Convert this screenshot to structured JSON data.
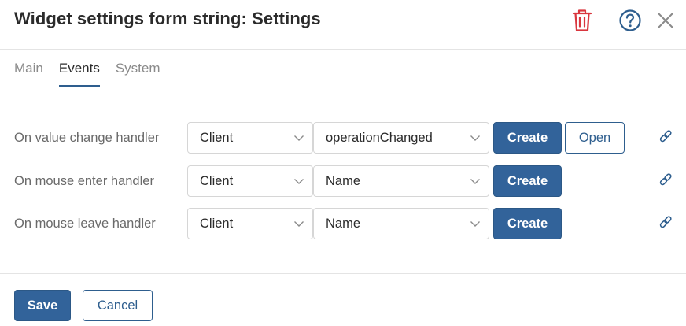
{
  "header": {
    "title": "Widget settings form string: Settings",
    "delete_icon": "trash-icon",
    "help_icon": "help-circle-icon",
    "close_icon": "close-icon",
    "delete_color": "#d9363e",
    "accent_color": "#2e5e8e"
  },
  "tabs": [
    {
      "label": "Main",
      "active": false
    },
    {
      "label": "Events",
      "active": true
    },
    {
      "label": "System",
      "active": false
    }
  ],
  "rows": [
    {
      "label": "On value change handler",
      "type": "Client",
      "handler": "operationChanged",
      "create_label": "Create",
      "open_label": "Open"
    },
    {
      "label": "On mouse enter handler",
      "type": "Client",
      "handler": "Name",
      "create_label": "Create"
    },
    {
      "label": "On mouse leave handler",
      "type": "Client",
      "handler": "Name",
      "create_label": "Create"
    }
  ],
  "footer": {
    "save_label": "Save",
    "cancel_label": "Cancel"
  }
}
